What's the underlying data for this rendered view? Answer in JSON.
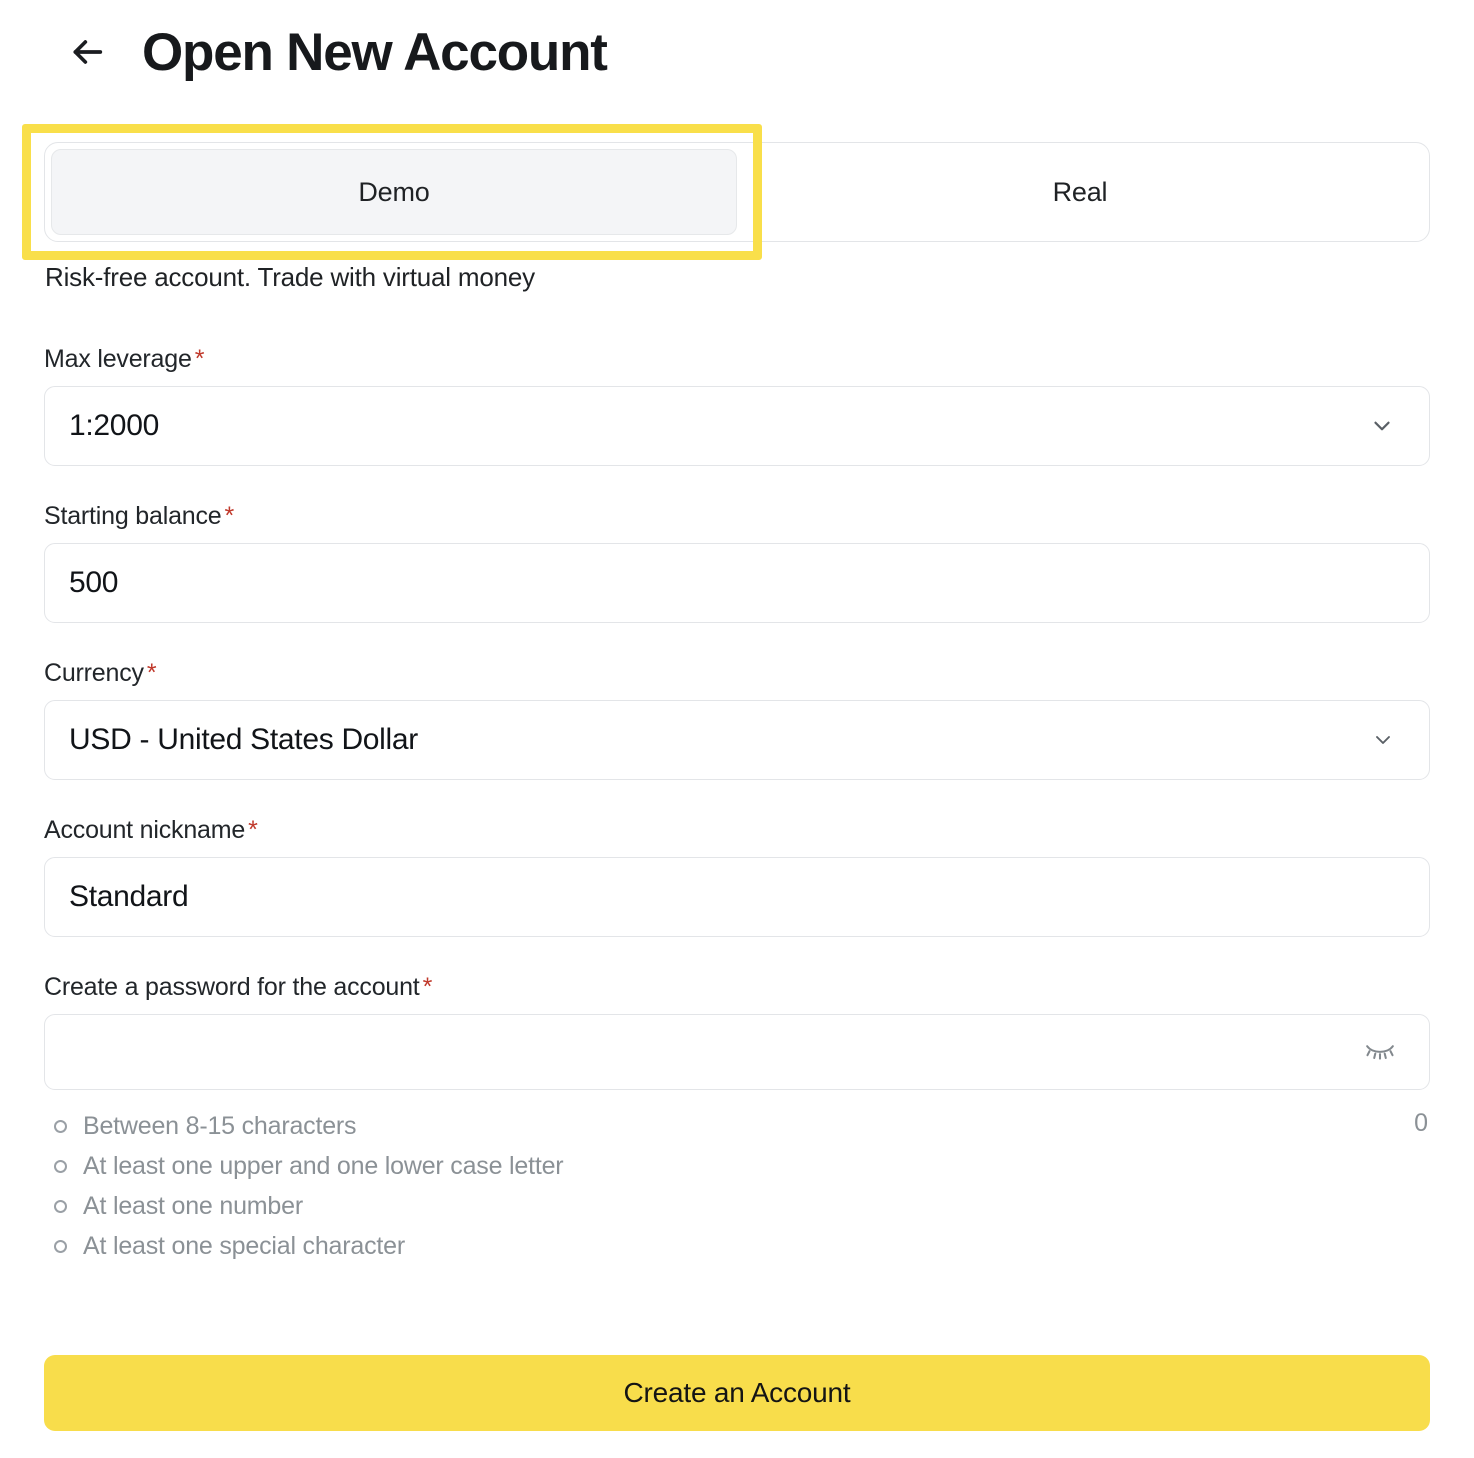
{
  "header": {
    "back_icon": "arrow-left-icon",
    "title": "Open New Account"
  },
  "account_type_tabs": {
    "highlighted_tab": "Demo",
    "items": [
      {
        "label": "Demo",
        "active": true
      },
      {
        "label": "Real",
        "active": false
      }
    ],
    "description": "Risk-free account. Trade with virtual money"
  },
  "form": {
    "max_leverage": {
      "label": "Max leverage",
      "required_marker": "*",
      "value": "1:2000",
      "icon": "chevron-down-icon"
    },
    "starting_balance": {
      "label": "Starting balance",
      "required_marker": "*",
      "value": "500"
    },
    "currency": {
      "label": "Currency",
      "required_marker": "*",
      "value": "USD - United States Dollar",
      "icon": "chevron-down-icon"
    },
    "account_nickname": {
      "label": "Account nickname",
      "required_marker": "*",
      "value": "Standard"
    },
    "password": {
      "label": "Create a password for the account",
      "required_marker": "*",
      "value": "",
      "placeholder": "",
      "toggle_icon": "eye-off-icon",
      "char_count": "0",
      "requirements": [
        "Between 8-15 characters",
        "At least one upper and one lower case letter",
        "At least one number",
        "At least one special character"
      ]
    }
  },
  "submit": {
    "label": "Create an Account"
  },
  "colors": {
    "accent_yellow": "#f8dd4b",
    "highlight_yellow": "#f9df4a",
    "required_red": "#c0392b",
    "border_gray": "#e3e5e8",
    "muted_text": "#8b9196",
    "title_dark": "#17191c"
  }
}
